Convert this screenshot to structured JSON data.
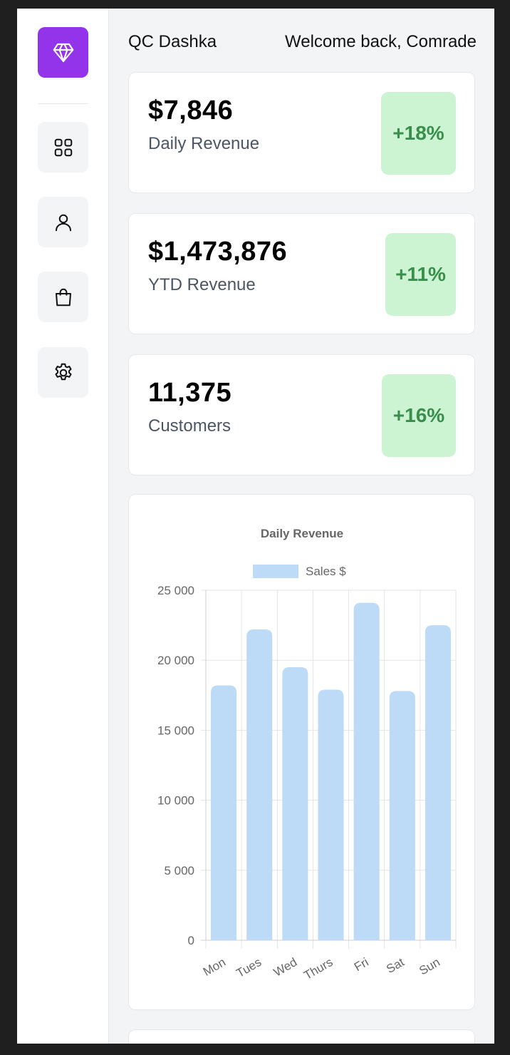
{
  "app": {
    "title": "QC Dashka",
    "welcome": "Welcome back, Comrade"
  },
  "sidebar": {
    "logo_icon": "gem-icon",
    "accent_color": "#9333ea",
    "items": [
      {
        "icon": "grid-icon"
      },
      {
        "icon": "user-icon"
      },
      {
        "icon": "shopping-bag-icon"
      },
      {
        "icon": "gear-icon"
      }
    ]
  },
  "stats": [
    {
      "value": "$7,846",
      "label": "Daily Revenue",
      "change": "+18%"
    },
    {
      "value": "$1,473,876",
      "label": "YTD Revenue",
      "change": "+11%"
    },
    {
      "value": "11,375",
      "label": "Customers",
      "change": "+16%"
    }
  ],
  "colors": {
    "badge_bg": "#ccf4d3",
    "badge_text": "#388e4a",
    "bar_fill": "#bddbf6"
  },
  "chart_data": {
    "type": "bar",
    "title": "Daily Revenue",
    "categories": [
      "Mon",
      "Tues",
      "Wed",
      "Thurs",
      "Fri",
      "Sat",
      "Sun"
    ],
    "series": [
      {
        "name": "Sales $",
        "values": [
          18200,
          22200,
          19500,
          17900,
          24100,
          17800,
          22500
        ]
      }
    ],
    "ylim": [
      0,
      25000
    ],
    "yticks": [
      0,
      5000,
      10000,
      15000,
      20000,
      25000
    ],
    "ytick_labels": [
      "0",
      "5 000",
      "10 000",
      "15 000",
      "20 000",
      "25 000"
    ],
    "legend": "top",
    "grid": true
  }
}
